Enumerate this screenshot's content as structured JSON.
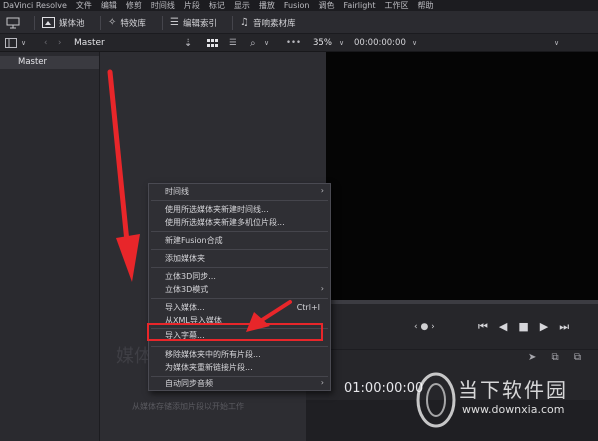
{
  "menubar": {
    "items": [
      "DaVinci Resolve",
      "文件",
      "编辑",
      "修剪",
      "时间线",
      "片段",
      "标记",
      "显示",
      "播放",
      "Fusion",
      "调色",
      "Fairlight",
      "工作区",
      "帮助"
    ]
  },
  "toolbar": {
    "media_pool": "媒体池",
    "effects": "特效库",
    "edit_index": "编辑索引",
    "sound_library": "音响素材库"
  },
  "subbar": {
    "bin_name": "Master",
    "zoom": "35%",
    "timecode": "00:00:00:00"
  },
  "binlist": {
    "master": "Master"
  },
  "mediapool": {
    "watermark_big": "媒体",
    "empty_hint": "从媒体存储添加片段以开始工作"
  },
  "transport": {
    "timecode": "01:00:00:00"
  },
  "context_menu": {
    "items": [
      {
        "label": "时间线",
        "submenu": true
      },
      {
        "label": "使用所选媒体夹新建时间线..."
      },
      {
        "label": "使用所选媒体夹新建多机位片段..."
      },
      {
        "label": "新建Fusion合成"
      },
      {
        "label": "添加媒体夹"
      },
      {
        "label": "立体3D同步..."
      },
      {
        "label": "立体3D模式",
        "submenu": true
      },
      {
        "label": "导入媒体...",
        "shortcut": "Ctrl+I"
      },
      {
        "label": "从XML导入媒体"
      },
      {
        "label": "导入字幕..."
      },
      {
        "label": "移除媒体夹中的所有片段..."
      },
      {
        "label": "为媒体夹重新链接片段..."
      },
      {
        "label": "自动同步音频",
        "submenu": true
      }
    ]
  },
  "watermark": {
    "brand": "当下软件园",
    "url": "www.downxia.com"
  },
  "colors": {
    "highlight_border": "#e8262a",
    "arrow": "#e8262a",
    "viewer": "#050505"
  }
}
